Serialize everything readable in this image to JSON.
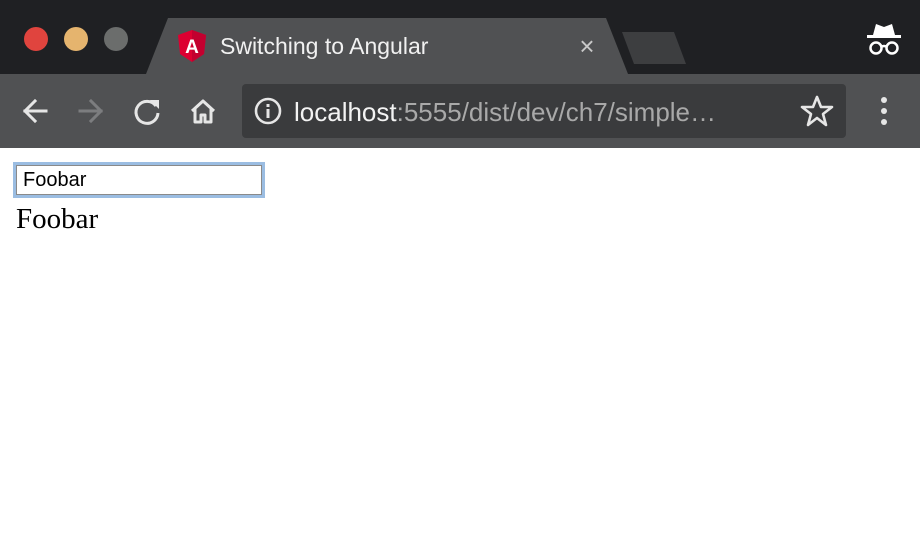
{
  "window": {
    "controls": [
      "close",
      "minimize",
      "maximize"
    ],
    "mode": "incognito",
    "incognito_icon": "incognito-icon"
  },
  "tab": {
    "title": "Switching to Angular",
    "favicon": "angular-logo-icon",
    "close_label": "×",
    "favicon_letter": "A"
  },
  "toolbar": {
    "icons": [
      "back-arrow-icon",
      "forward-arrow-icon",
      "reload-icon",
      "home-icon",
      "info-icon",
      "star-icon",
      "kebab-menu-icon"
    ],
    "forward_enabled": false
  },
  "omnibox": {
    "host": "localhost",
    "path": ":5555/dist/dev/ch7/simple…"
  },
  "page": {
    "input_value": "Foobar",
    "echo_text": "Foobar"
  },
  "colors": {
    "titlebar": "#1f2023",
    "toolbar": "#505153",
    "omnibox": "#3a3b3d",
    "angular_red": "#dd0031",
    "focus_ring": "#9bbde2"
  }
}
